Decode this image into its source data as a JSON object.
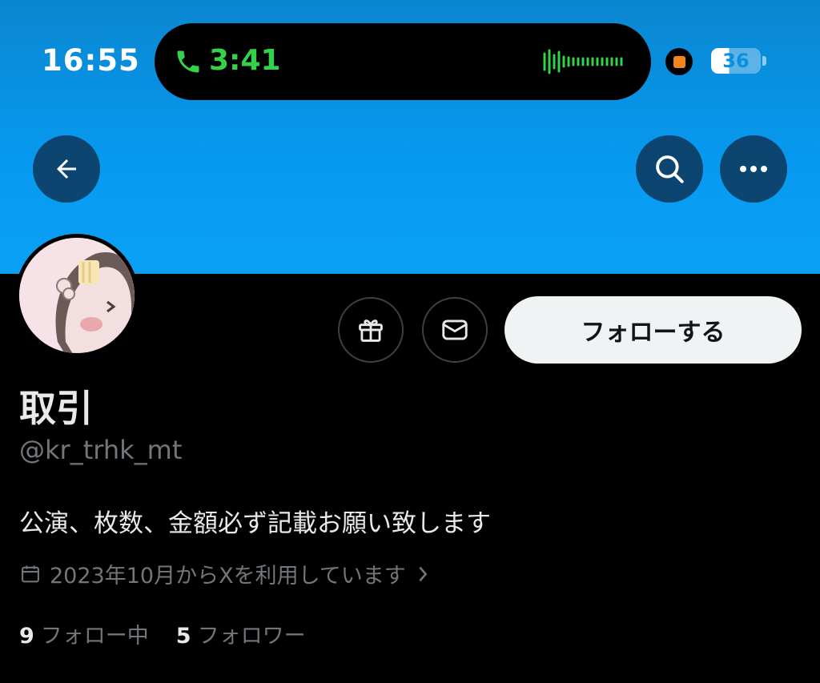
{
  "status_bar": {
    "time": "16:55",
    "call_timer": "3:41",
    "battery_level": "36",
    "call_color": "#35d14a",
    "recording_color": "#f2861d"
  },
  "header": {
    "banner_color": "#079af0",
    "icons": [
      "arrow-left-icon",
      "search-icon",
      "more-horizontal-icon"
    ]
  },
  "profile": {
    "display_name": "取引",
    "handle": "@kr_trhk_mt",
    "bio": "公演、枚数、金額必ず記載お願い致します",
    "joined": "2023年10月からXを利用しています",
    "following_count": "9",
    "following_label": "フォロー中",
    "followers_count": "5",
    "followers_label": "フォロワー"
  },
  "actions": {
    "follow_label": "フォローする",
    "icons": [
      "gift-icon",
      "envelope-icon"
    ]
  }
}
